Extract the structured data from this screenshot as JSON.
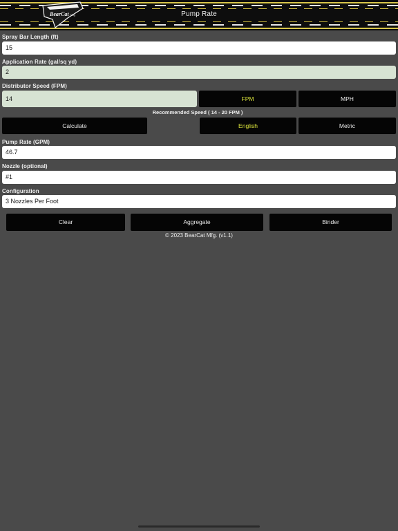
{
  "header": {
    "title": "Pump Rate",
    "logo_text": "BearCat Mfg"
  },
  "spray_bar": {
    "label": "Spray Bar Length  (ft)",
    "value": "15"
  },
  "application_rate": {
    "label": "Application Rate  (gal/sq yd)",
    "value": "2"
  },
  "distributor_speed": {
    "label": "Distributor Speed  (FPM)",
    "value": "14",
    "units": {
      "fpm": "FPM",
      "mph": "MPH",
      "selected": "FPM"
    }
  },
  "recommended": "Recommended Speed    ( 14 - 20 FPM )",
  "actions": {
    "calculate": "Calculate",
    "english": "English",
    "metric": "Metric",
    "system_selected": "English"
  },
  "pump_rate": {
    "label": "Pump Rate  (GPM)",
    "value": "46.7"
  },
  "nozzle": {
    "label": "Nozzle (optional)",
    "value": "#1"
  },
  "configuration": {
    "label": "Configuration",
    "value": "3 Nozzles Per Foot"
  },
  "bottom_buttons": {
    "clear": "Clear",
    "aggregate": "Aggregate",
    "binder": "Binder"
  },
  "footer": "© 2023 BearCat Mfg. (v1.1)",
  "colors": {
    "accent_yellow": "#d9e23b",
    "field_green": "#d7e3d3",
    "background": "#4a4a4a"
  }
}
